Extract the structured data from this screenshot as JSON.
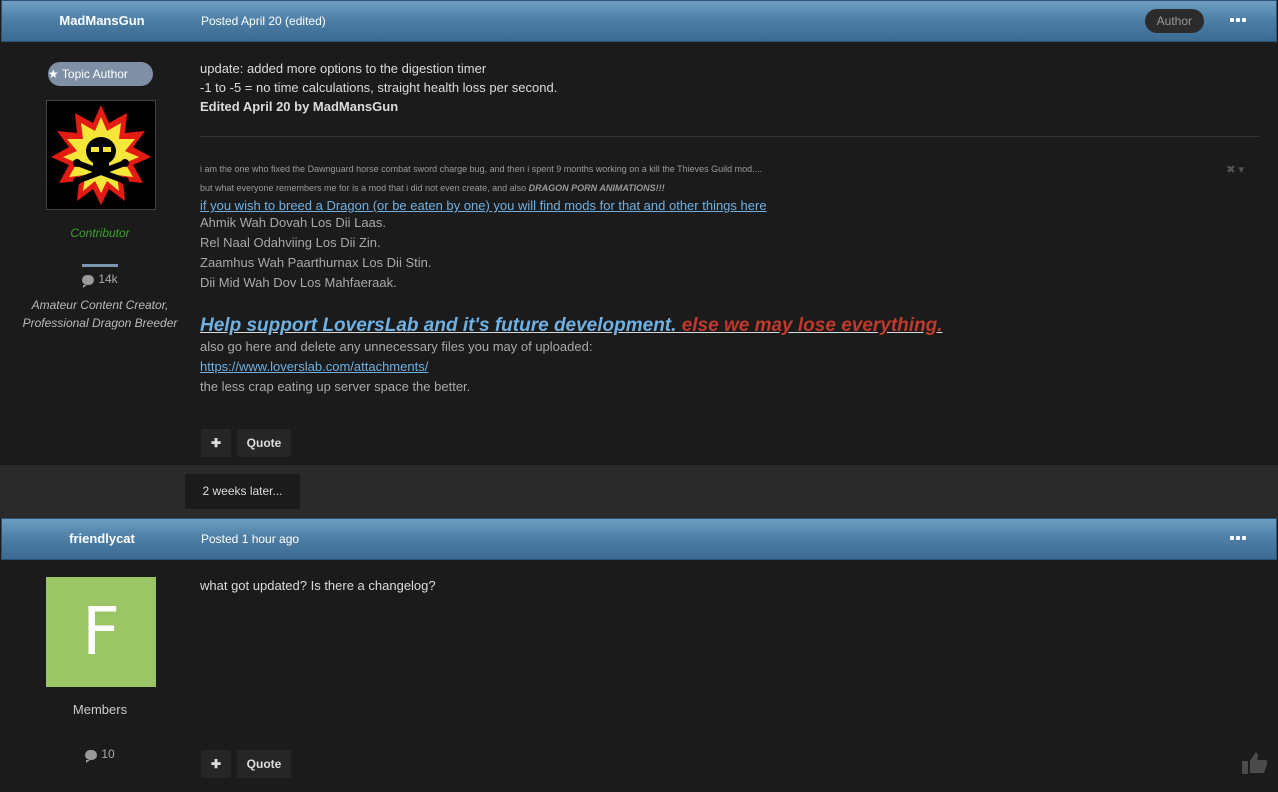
{
  "post1": {
    "author": "MadMansGun",
    "posted": "Posted April 20 (edited)",
    "author_badge": "Author",
    "topic_author_badge": "Topic Author",
    "group": "Contributor",
    "post_count": "14k",
    "member_title_line1": "Amateur Content Creator,",
    "member_title_line2": "Professional Dragon Breeder",
    "body_line1": "update: added more options to the digestion timer",
    "body_line2": "-1 to -5 = no time calculations, straight health loss per second.",
    "edited": "Edited April 20 by MadMansGun",
    "signature": {
      "small1": "i am the one who fixed the Dawnguard horse combat sword charge bug, and then i spent 9 months working on a kill the Thieves Guild mod....",
      "small2_prefix": "but what everyone remembers me for is a mod that i did not even create, and also ",
      "small2_bold": "DRAGON PORN ANIMATIONS!!!",
      "link1": "if you wish to breed a Dragon (or be eaten by one) you will find mods for that and other things here",
      "line1": "Ahmik Wah Dovah Los Dii Laas.",
      "line2": "Rel Naal Odahviing Los Dii Zin.",
      "line3": "Zaamhus Wah Paarthurnax Los Dii Stin.",
      "line4": "Dii Mid Wah Dov Los Mahfaeraak.",
      "big_blue": "Help support LoversLab and it's future development.",
      "big_red": "else we may lose everything.",
      "also": "also go here and delete any unnecessary files you may of uploaded:",
      "url": "https://www.loverslab.com/attachments/",
      "less": "the less crap eating up server space the better."
    },
    "quote_label": "Quote",
    "plus_label": "✚"
  },
  "time_gap": "2 weeks later...",
  "post2": {
    "author": "friendlycat",
    "posted": "Posted 1 hour ago",
    "avatar_letter": "F",
    "group": "Members",
    "post_count": "10",
    "body": "what got updated? Is there a changelog?",
    "quote_label": "Quote",
    "plus_label": "✚"
  },
  "colors": {
    "header_blue": "#4f80a8",
    "link_blue": "#6fb1e3",
    "warning_red": "#c0392b",
    "contributor_green": "#3aa329",
    "avatar_green": "#9cc566"
  }
}
